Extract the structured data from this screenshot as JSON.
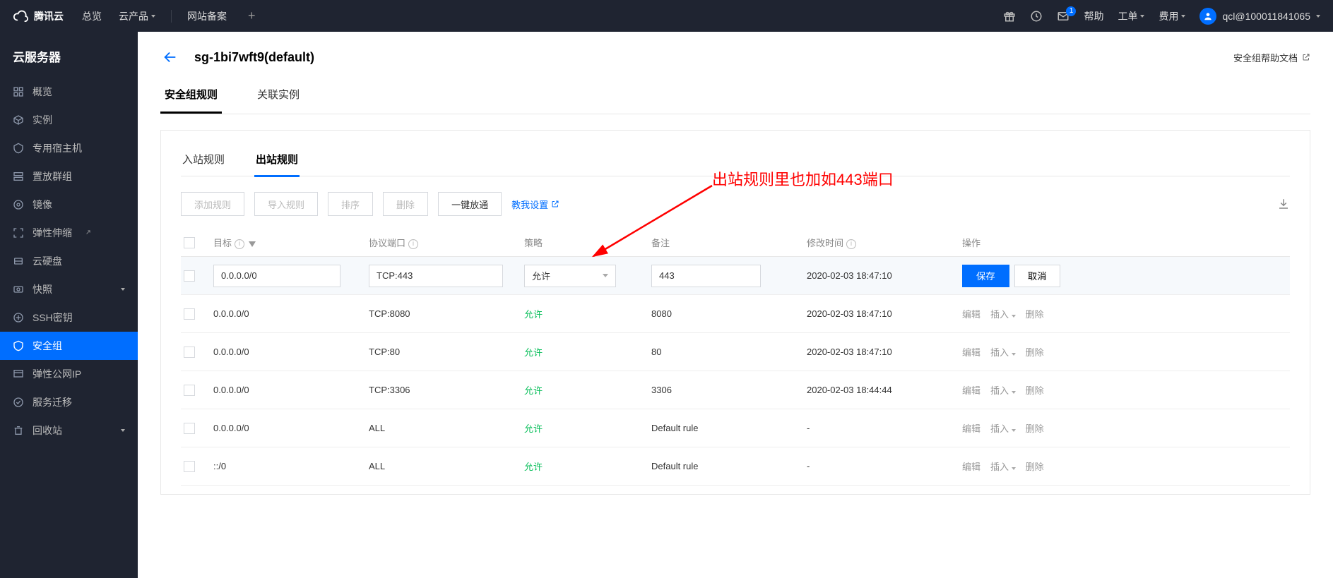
{
  "top": {
    "brand": "腾讯云",
    "nav": {
      "overview": "总览",
      "products": "云产品",
      "beian": "网站备案"
    },
    "help": "帮助",
    "ticket": "工单",
    "cost": "费用",
    "mail_badge": "1",
    "user": "qcl@100011841065"
  },
  "sidebar": {
    "title": "云服务器",
    "items": [
      {
        "label": "概览"
      },
      {
        "label": "实例"
      },
      {
        "label": "专用宿主机"
      },
      {
        "label": "置放群组"
      },
      {
        "label": "镜像"
      },
      {
        "label": "弹性伸缩",
        "ext": true
      },
      {
        "label": "云硬盘"
      },
      {
        "label": "快照",
        "collapse": true
      },
      {
        "label": "SSH密钥"
      },
      {
        "label": "安全组",
        "active": true
      },
      {
        "label": "弹性公网IP"
      },
      {
        "label": "服务迁移"
      },
      {
        "label": "回收站",
        "collapse": true
      }
    ]
  },
  "page": {
    "title": "sg-1bi7wft9(default)",
    "helpdoc": "安全组帮助文档",
    "tabs": {
      "rules": "安全组规则",
      "assoc": "关联实例"
    },
    "subtabs": {
      "inbound": "入站规则",
      "outbound": "出站规则"
    }
  },
  "toolbar": {
    "add": "添加规则",
    "import": "导入规则",
    "sort": "排序",
    "delete": "删除",
    "open": "一键放通",
    "teach": "教我设置"
  },
  "columns": {
    "target": "目标",
    "proto": "协议端口",
    "policy": "策略",
    "note": "备注",
    "time": "修改时间",
    "ops": "操作"
  },
  "edit_row": {
    "target_val": "0.0.0.0/0",
    "proto_val": "TCP:443",
    "policy_val": "允许",
    "note_val": "443",
    "time": "2020-02-03 18:47:10",
    "save": "保存",
    "cancel": "取消"
  },
  "rows": [
    {
      "target": "0.0.0.0/0",
      "proto": "TCP:8080",
      "policy": "允许",
      "note": "8080",
      "time": "2020-02-03 18:47:10"
    },
    {
      "target": "0.0.0.0/0",
      "proto": "TCP:80",
      "policy": "允许",
      "note": "80",
      "time": "2020-02-03 18:47:10"
    },
    {
      "target": "0.0.0.0/0",
      "proto": "TCP:3306",
      "policy": "允许",
      "note": "3306",
      "time": "2020-02-03 18:44:44"
    },
    {
      "target": "0.0.0.0/0",
      "proto": "ALL",
      "policy": "允许",
      "note": "Default rule",
      "time": "-"
    },
    {
      "target": "::/0",
      "proto": "ALL",
      "policy": "允许",
      "note": "Default rule",
      "time": "-"
    }
  ],
  "row_ops": {
    "edit": "编辑",
    "insert": "插入",
    "delete": "删除"
  },
  "annotation": "出站规则里也加如443端口"
}
